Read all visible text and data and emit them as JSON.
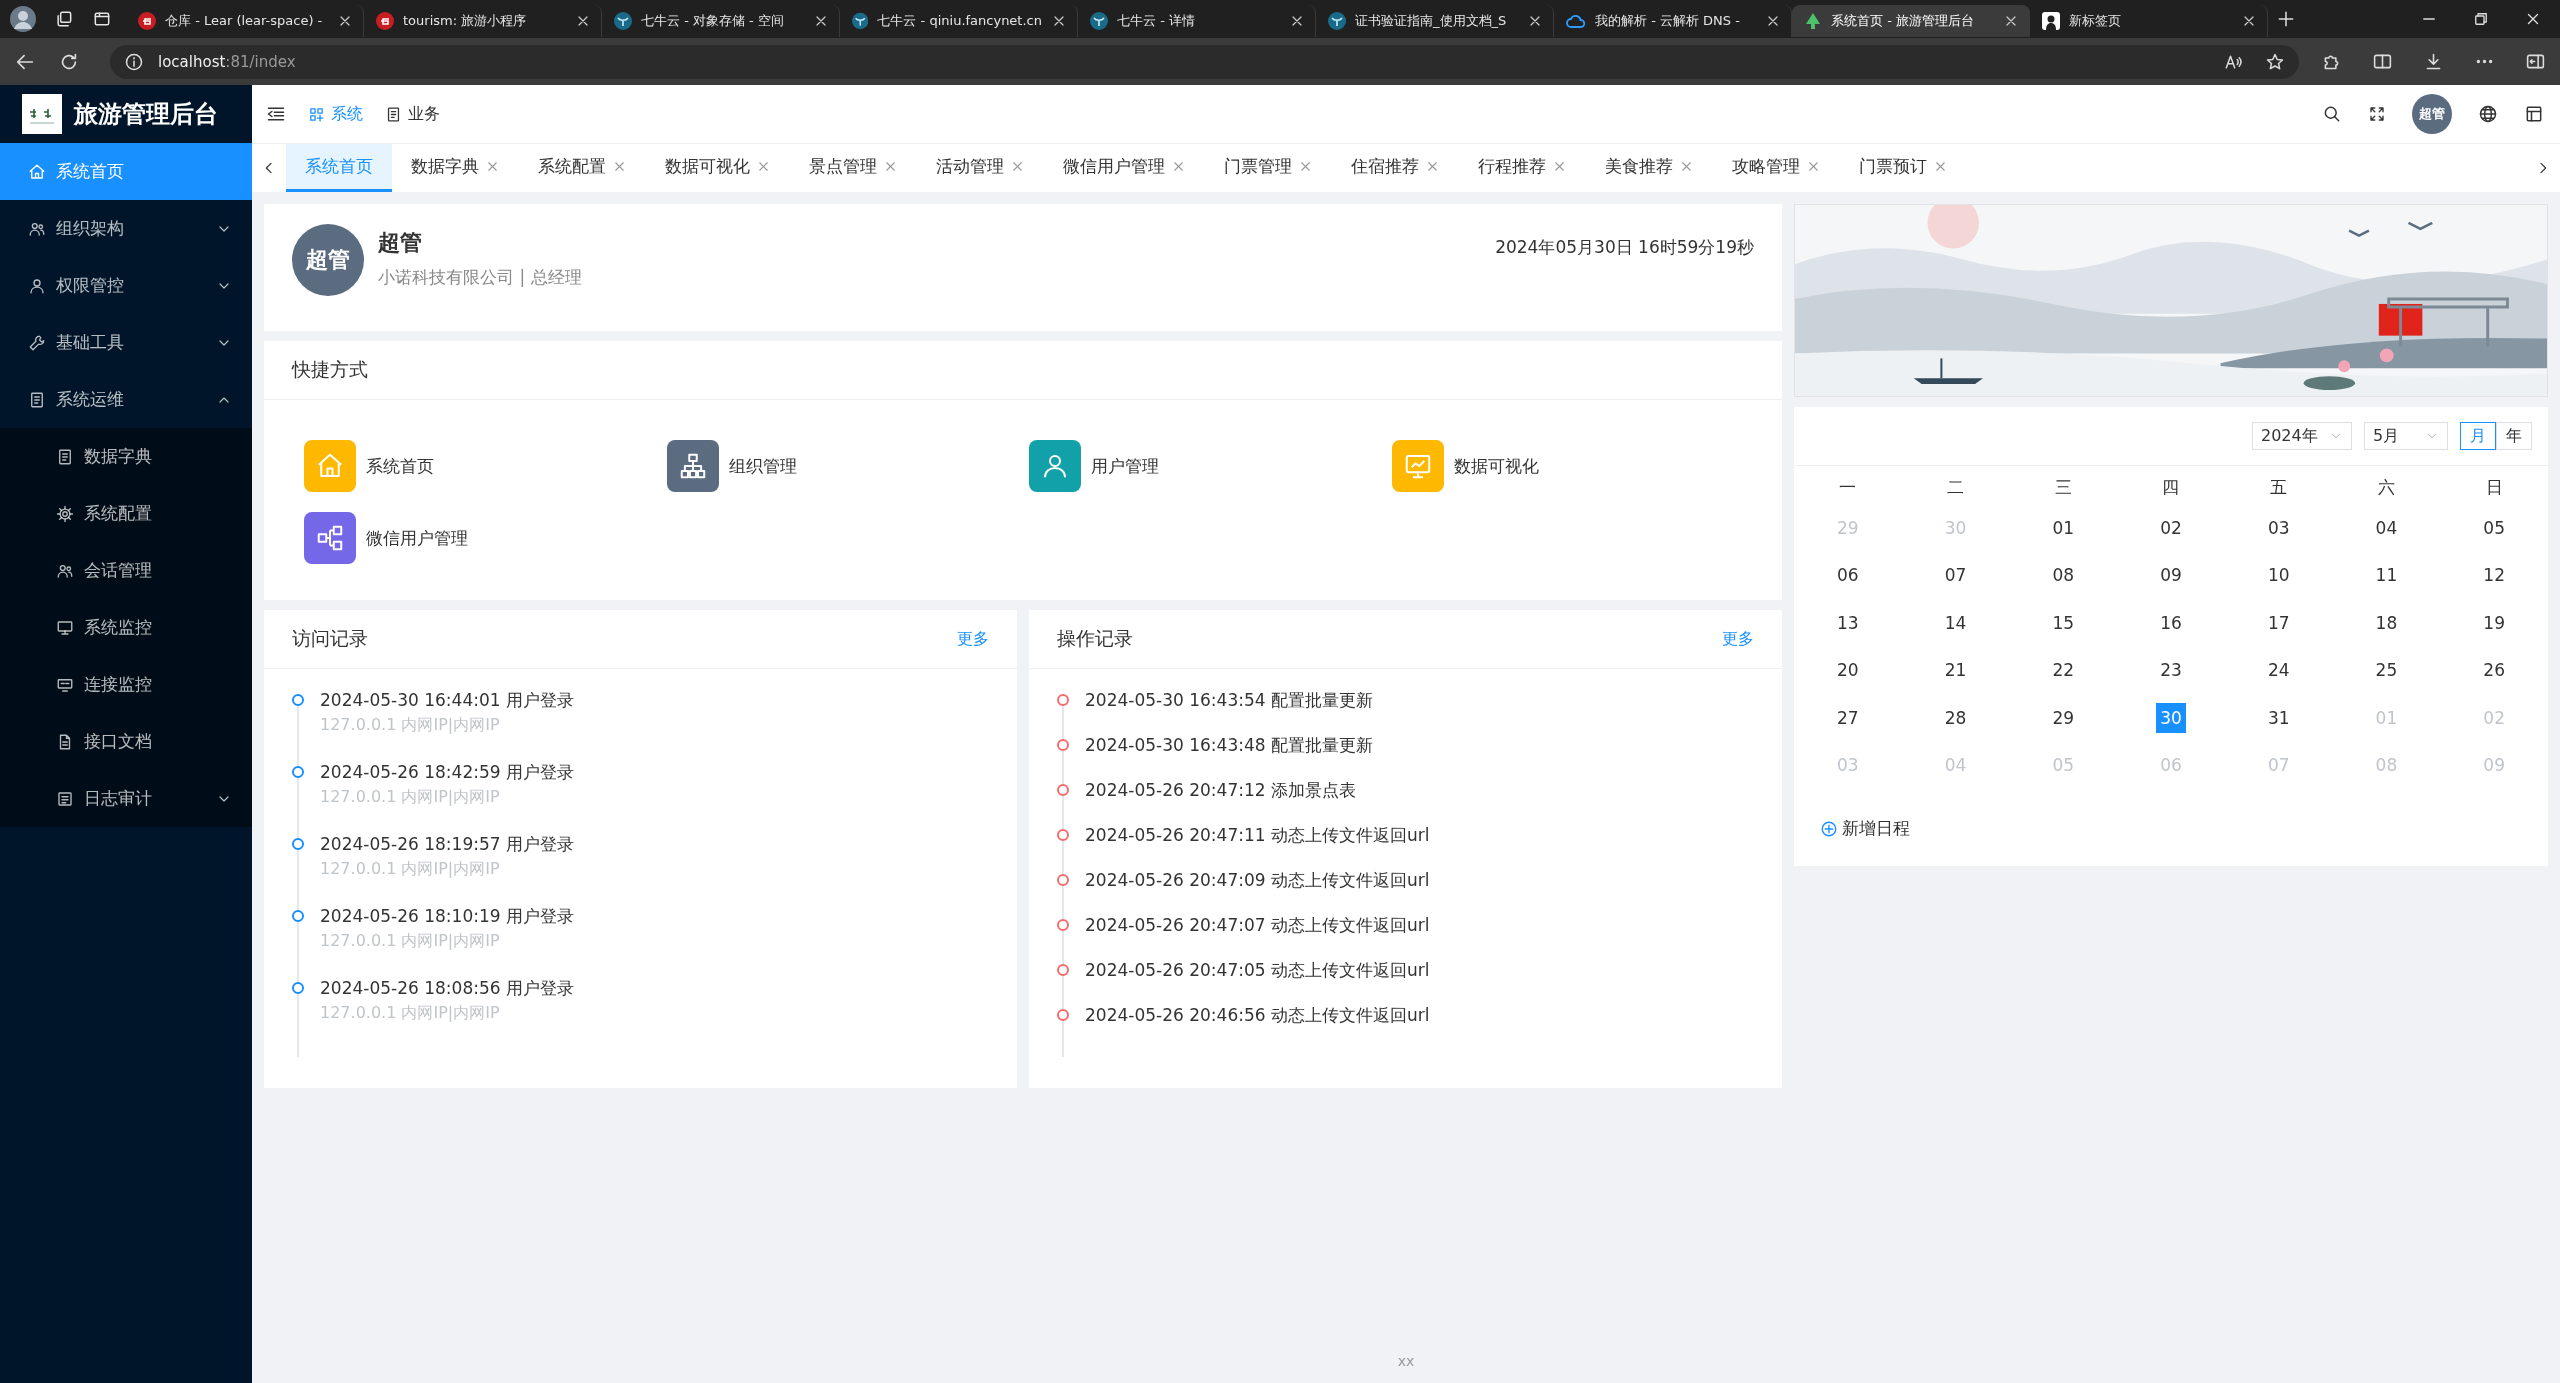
{
  "browser": {
    "tabs": [
      {
        "title": "仓库 - Lear (lear-space) -",
        "selected": false
      },
      {
        "title": "tourism: 旅游小程序",
        "selected": false
      },
      {
        "title": "七牛云 - 对象存储 - 空间",
        "selected": false
      },
      {
        "title": "七牛云 - qiniu.fancynet.cn",
        "selected": false
      },
      {
        "title": "七牛云 - 详情",
        "selected": false
      },
      {
        "title": "证书验证指南_使用文档_S",
        "selected": false
      },
      {
        "title": "我的解析 - 云解析 DNS -",
        "selected": false
      },
      {
        "title": "系统首页 - 旅游管理后台",
        "selected": true
      },
      {
        "title": "新标签页",
        "selected": false
      }
    ],
    "address": {
      "host": "localhost",
      "path": ":81/index"
    }
  },
  "app": {
    "title": "旅游管理后台"
  },
  "sidebar": {
    "items": [
      {
        "label": "系统首页",
        "kind": "link",
        "selected": true
      },
      {
        "label": "组织架构",
        "kind": "group",
        "selected": false,
        "expanded": false
      },
      {
        "label": "权限管控",
        "kind": "group",
        "selected": false,
        "expanded": false
      },
      {
        "label": "基础工具",
        "kind": "group",
        "selected": false,
        "expanded": false
      },
      {
        "label": "系统运维",
        "kind": "group",
        "selected": false,
        "expanded": true,
        "children": [
          {
            "label": "数据字典",
            "kind": "link",
            "selected": false
          },
          {
            "label": "系统配置",
            "kind": "link",
            "selected": false
          },
          {
            "label": "会话管理",
            "kind": "link",
            "selected": false
          },
          {
            "label": "系统监控",
            "kind": "link",
            "selected": false
          },
          {
            "label": "连接监控",
            "kind": "link",
            "selected": false
          },
          {
            "label": "接口文档",
            "kind": "link",
            "selected": false
          },
          {
            "label": "日志审计",
            "kind": "group",
            "selected": false,
            "expanded": false
          }
        ]
      }
    ]
  },
  "top_menu": [
    {
      "label": "系统",
      "selected": true
    },
    {
      "label": "业务",
      "selected": false
    }
  ],
  "header": {
    "avatar": "超管"
  },
  "tabs": [
    {
      "label": "系统首页",
      "selected": true,
      "closable": false
    },
    {
      "label": "数据字典",
      "selected": false,
      "closable": true
    },
    {
      "label": "系统配置",
      "selected": false,
      "closable": true
    },
    {
      "label": "数据可视化",
      "selected": false,
      "closable": true
    },
    {
      "label": "景点管理",
      "selected": false,
      "closable": true
    },
    {
      "label": "活动管理",
      "selected": false,
      "closable": true
    },
    {
      "label": "微信用户管理",
      "selected": false,
      "closable": true
    },
    {
      "label": "门票管理",
      "selected": false,
      "closable": true
    },
    {
      "label": "住宿推荐",
      "selected": false,
      "closable": true
    },
    {
      "label": "行程推荐",
      "selected": false,
      "closable": true
    },
    {
      "label": "美食推荐",
      "selected": false,
      "closable": true
    },
    {
      "label": "攻略管理",
      "selected": false,
      "closable": true
    },
    {
      "label": "门票预订",
      "selected": false,
      "closable": true
    }
  ],
  "user_card": {
    "avatar": "超管",
    "name": "超管",
    "subtitle": "小诺科技有限公司 | 总经理",
    "datetime": "2024年05月30日 16时59分19秒"
  },
  "shortcuts": {
    "title": "快捷方式",
    "items": [
      {
        "label": "系统首页",
        "color": "#ffb800"
      },
      {
        "label": "组织管理",
        "color": "#5b6b80"
      },
      {
        "label": "用户管理",
        "color": "#12a1a8"
      },
      {
        "label": "数据可视化",
        "color": "#ffb800"
      },
      {
        "label": "微信用户管理",
        "color": "#7467e8"
      }
    ]
  },
  "visit_log": {
    "title": "访问记录",
    "more": "更多",
    "items": [
      {
        "text": "2024-05-30 16:44:01 用户登录",
        "detail": "127.0.0.1 内网IP|内网IP"
      },
      {
        "text": "2024-05-26 18:42:59 用户登录",
        "detail": "127.0.0.1 内网IP|内网IP"
      },
      {
        "text": "2024-05-26 18:19:57 用户登录",
        "detail": "127.0.0.1 内网IP|内网IP"
      },
      {
        "text": "2024-05-26 18:10:19 用户登录",
        "detail": "127.0.0.1 内网IP|内网IP"
      },
      {
        "text": "2024-05-26 18:08:56 用户登录",
        "detail": "127.0.0.1 内网IP|内网IP"
      }
    ]
  },
  "operation_log": {
    "title": "操作记录",
    "more": "更多",
    "items": [
      {
        "text": "2024-05-30 16:43:54 配置批量更新"
      },
      {
        "text": "2024-05-30 16:43:48 配置批量更新"
      },
      {
        "text": "2024-05-26 20:47:12 添加景点表"
      },
      {
        "text": "2024-05-26 20:47:11 动态上传文件返回url"
      },
      {
        "text": "2024-05-26 20:47:09 动态上传文件返回url"
      },
      {
        "text": "2024-05-26 20:47:07 动态上传文件返回url"
      },
      {
        "text": "2024-05-26 20:47:05 动态上传文件返回url"
      },
      {
        "text": "2024-05-26 20:46:56 动态上传文件返回url"
      }
    ]
  },
  "calendar": {
    "year": "2024年",
    "month": "5月",
    "views": [
      {
        "label": "月",
        "selected": true
      },
      {
        "label": "年",
        "selected": false
      }
    ],
    "weekdays": [
      "一",
      "二",
      "三",
      "四",
      "五",
      "六",
      "日"
    ],
    "days": [
      {
        "label": "29",
        "current_month": false,
        "selected": false
      },
      {
        "label": "30",
        "current_month": false,
        "selected": false
      },
      {
        "label": "01",
        "current_month": true,
        "selected": false
      },
      {
        "label": "02",
        "current_month": true,
        "selected": false
      },
      {
        "label": "03",
        "current_month": true,
        "selected": false
      },
      {
        "label": "04",
        "current_month": true,
        "selected": false
      },
      {
        "label": "05",
        "current_month": true,
        "selected": false
      },
      {
        "label": "06",
        "current_month": true,
        "selected": false
      },
      {
        "label": "07",
        "current_month": true,
        "selected": false
      },
      {
        "label": "08",
        "current_month": true,
        "selected": false
      },
      {
        "label": "09",
        "current_month": true,
        "selected": false
      },
      {
        "label": "10",
        "current_month": true,
        "selected": false
      },
      {
        "label": "11",
        "current_month": true,
        "selected": false
      },
      {
        "label": "12",
        "current_month": true,
        "selected": false
      },
      {
        "label": "13",
        "current_month": true,
        "selected": false
      },
      {
        "label": "14",
        "current_month": true,
        "selected": false
      },
      {
        "label": "15",
        "current_month": true,
        "selected": false
      },
      {
        "label": "16",
        "current_month": true,
        "selected": false
      },
      {
        "label": "17",
        "current_month": true,
        "selected": false
      },
      {
        "label": "18",
        "current_month": true,
        "selected": false
      },
      {
        "label": "19",
        "current_month": true,
        "selected": false
      },
      {
        "label": "20",
        "current_month": true,
        "selected": false
      },
      {
        "label": "21",
        "current_month": true,
        "selected": false
      },
      {
        "label": "22",
        "current_month": true,
        "selected": false
      },
      {
        "label": "23",
        "current_month": true,
        "selected": false
      },
      {
        "label": "24",
        "current_month": true,
        "selected": false
      },
      {
        "label": "25",
        "current_month": true,
        "selected": false
      },
      {
        "label": "26",
        "current_month": true,
        "selected": false
      },
      {
        "label": "27",
        "current_month": true,
        "selected": false
      },
      {
        "label": "28",
        "current_month": true,
        "selected": false
      },
      {
        "label": "29",
        "current_month": true,
        "selected": false
      },
      {
        "label": "30",
        "current_month": true,
        "selected": true
      },
      {
        "label": "31",
        "current_month": true,
        "selected": false
      },
      {
        "label": "01",
        "current_month": false,
        "selected": false
      },
      {
        "label": "02",
        "current_month": false,
        "selected": false
      },
      {
        "label": "03",
        "current_month": false,
        "selected": false
      },
      {
        "label": "04",
        "current_month": false,
        "selected": false
      },
      {
        "label": "05",
        "current_month": false,
        "selected": false
      },
      {
        "label": "06",
        "current_month": false,
        "selected": false
      },
      {
        "label": "07",
        "current_month": false,
        "selected": false
      },
      {
        "label": "08",
        "current_month": false,
        "selected": false
      },
      {
        "label": "09",
        "current_month": false,
        "selected": false
      }
    ],
    "add_event": "新增日程"
  },
  "footer": "xx"
}
